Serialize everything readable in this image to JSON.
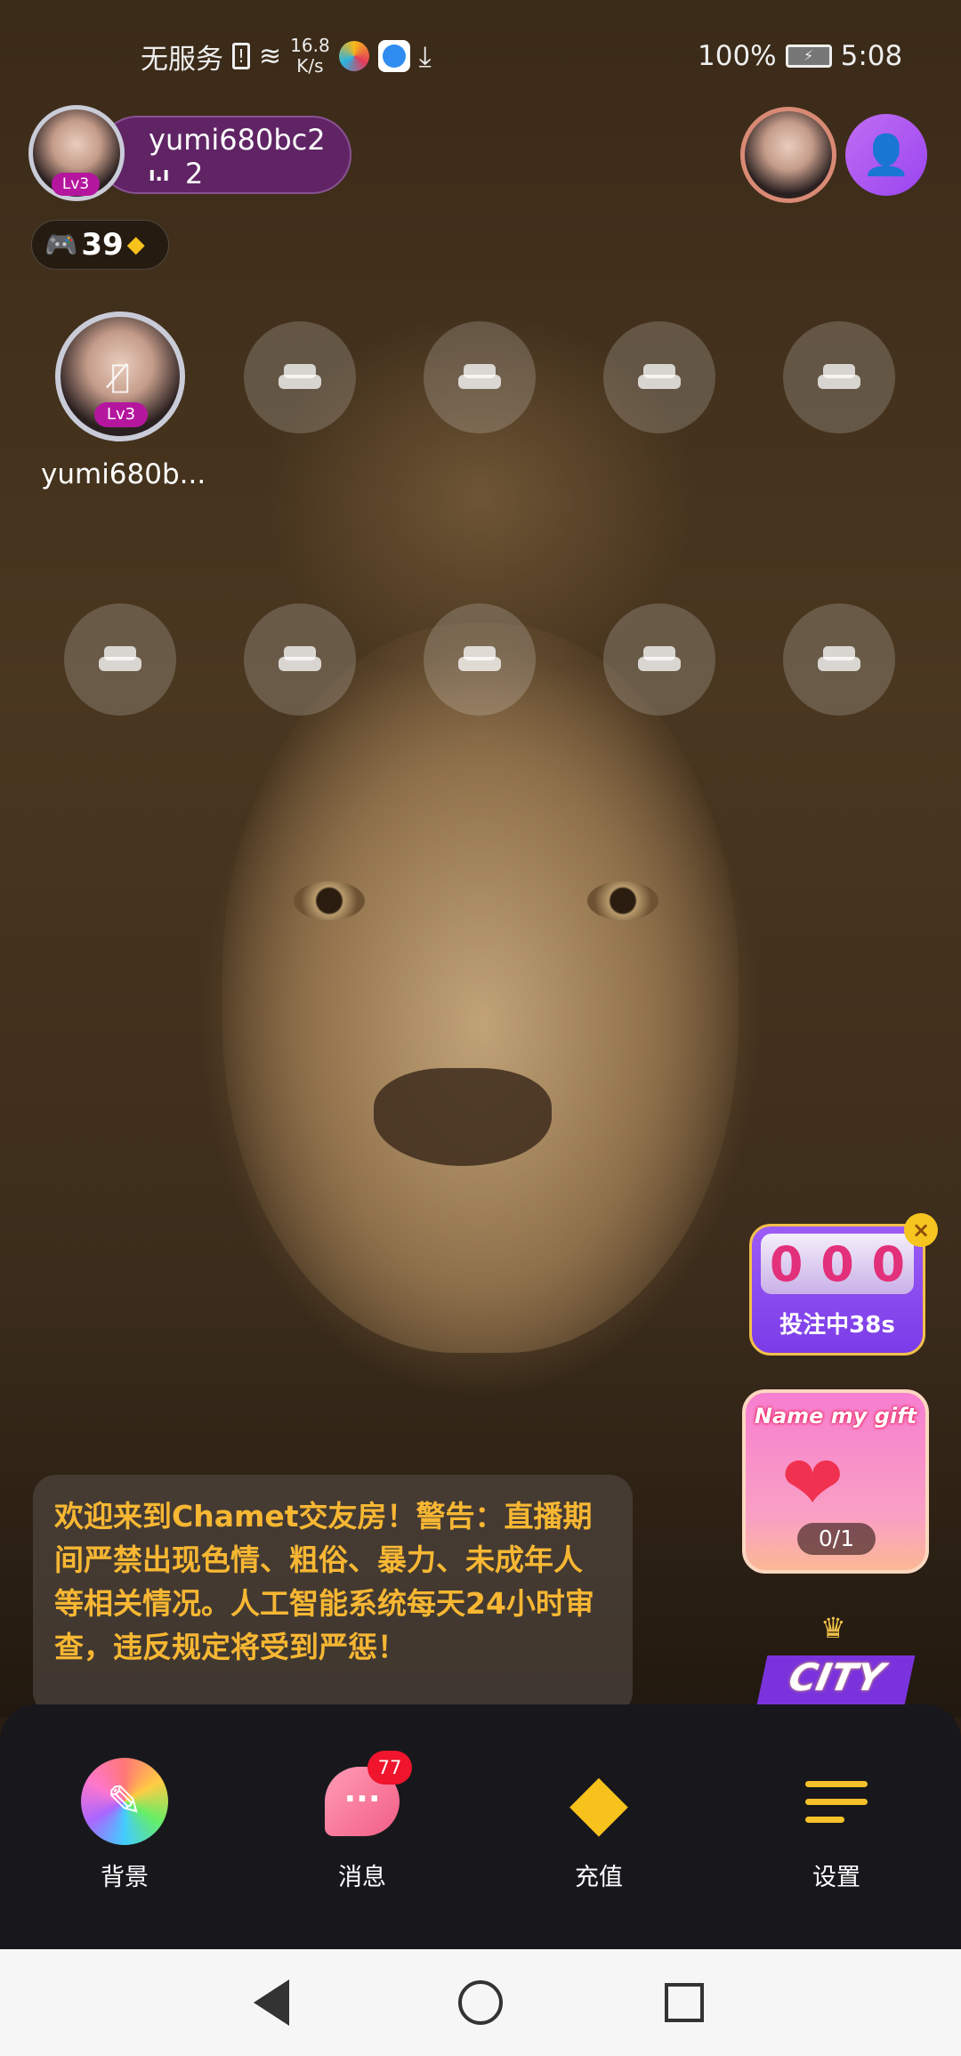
{
  "status_bar": {
    "carrier": "无服务",
    "net_speed_value": "16.8",
    "net_speed_unit": "K/s",
    "battery": "100%",
    "time": "5:08"
  },
  "host": {
    "name": "yumi680bc2",
    "level": "Lv3",
    "online_count": "2"
  },
  "coins": {
    "value": "39"
  },
  "seats": {
    "occupied_name": "yumi680b...",
    "occupied_level": "Lv3",
    "empty_count": 9
  },
  "game_widget": {
    "digits": [
      "0",
      "0",
      "0"
    ],
    "status": "投注中38s"
  },
  "gift_card": {
    "title": "Name my gift",
    "progress": "0/1"
  },
  "city_badge": {
    "label": "CITY"
  },
  "notice": {
    "text": "欢迎来到Chamet交友房！警告：直播期间严禁出现色情、粗俗、暴力、未成年人等相关情况。人工智能系统每天24小时审查，违反规定将受到严惩！"
  },
  "bottom_nav": [
    {
      "label": "背景",
      "icon": "brush-icon"
    },
    {
      "label": "消息",
      "icon": "chat-icon",
      "badge": "77"
    },
    {
      "label": "充值",
      "icon": "diamond-icon"
    },
    {
      "label": "设置",
      "icon": "menu-icon"
    }
  ],
  "colors": {
    "notice_text": "#f7b733",
    "pill": "#64236e",
    "accent_purple": "#a855f7"
  }
}
